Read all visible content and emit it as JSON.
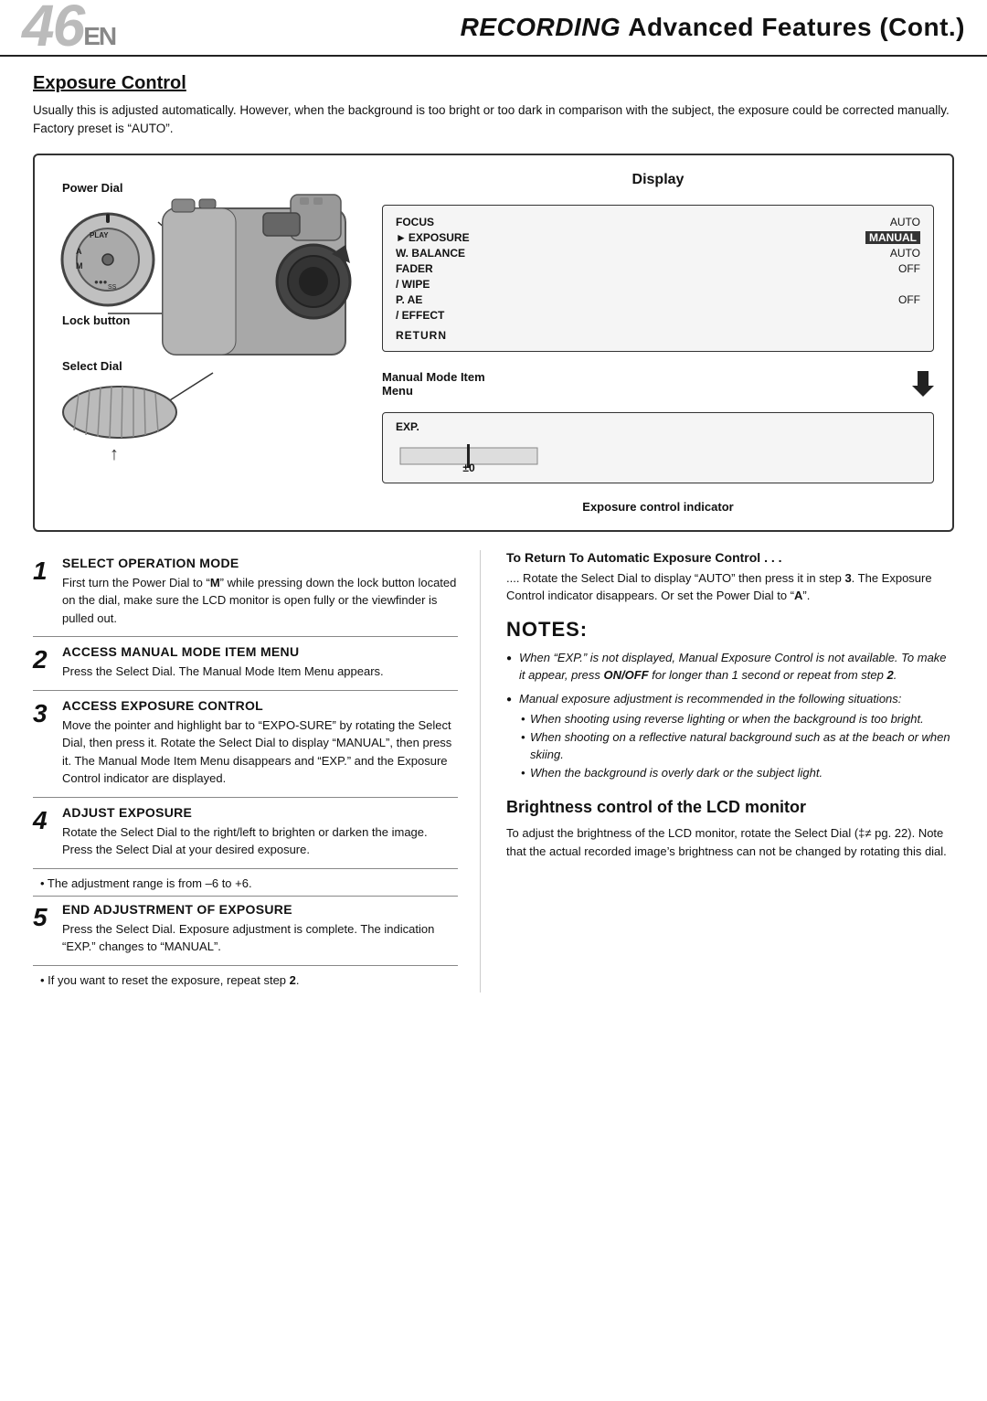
{
  "header": {
    "page_number": "46",
    "page_suffix": "EN",
    "title_italic": "RECORDING",
    "title_rest": "Advanced Features (Cont.)"
  },
  "exposure_control": {
    "heading": "Exposure Control",
    "intro": "Usually this is adjusted automatically. However, when the background is too bright or too dark in comparison with the subject, the exposure could be corrected manually. Factory preset is “AUTO”."
  },
  "diagram": {
    "display_label": "Display",
    "labels": {
      "power_dial": "Power Dial",
      "lock_button": "Lock button",
      "select_dial": "Select Dial",
      "exposure_control_indicator": "Exposure control indicator"
    },
    "display_menu": {
      "rows": [
        {
          "label": "FOCUS",
          "value": "AUTO"
        },
        {
          "label": "►EXPOSURE",
          "value": "MANUAL",
          "highlighted": true
        },
        {
          "label": "W. BALANCE",
          "value": "AUTO"
        },
        {
          "label": "FADER",
          "value": "OFF"
        },
        {
          "label": "/ WIPE",
          "value": ""
        },
        {
          "label": "P. AE",
          "value": "OFF"
        },
        {
          "label": "/ EFFECT",
          "value": ""
        }
      ],
      "return": "RETURN"
    },
    "manual_mode": {
      "label": "Manual Mode Item",
      "sublabel": "Menu"
    },
    "exp_box": {
      "title": "EXP.",
      "value": "±0"
    }
  },
  "steps": [
    {
      "num": "1",
      "title": "SELECT OPERATION MODE",
      "body": "First turn the Power Dial to “M” while pressing down the lock button located on the dial, make sure the LCD monitor is open fully or the viewfinder is pulled out."
    },
    {
      "num": "2",
      "title": "ACCESS MANUAL MODE ITEM MENU",
      "body": "Press the Select Dial. The Manual Mode Item Menu appears."
    },
    {
      "num": "3",
      "title": "ACCESS EXPOSURE CONTROL",
      "body": "Move the pointer and highlight bar to “EXPO-SURE” by rotating the Select Dial, then press it. Rotate the Select Dial to display “MANUAL”, then press it. The Manual Mode Item Menu disappears and “EXP.” and the Exposure Control indicator are displayed."
    },
    {
      "num": "4",
      "title": "ADJUST EXPOSURE",
      "body": "Rotate the Select Dial to the right/left to brighten or darken the image. Press the Select Dial at your desired exposure."
    },
    {
      "num": "4",
      "step_override": true,
      "bullet": "• The adjustment range is from –6 to +6."
    },
    {
      "num": "5",
      "title": "END ADJUSTRMENT OF EXPOSURE",
      "body": "Press the Select Dial. Exposure adjustment is complete. The indication “EXP.” changes to “MANUAL”."
    },
    {
      "num": "5",
      "step_override": true,
      "bullet": "• If you want to reset the exposure, repeat step 2."
    }
  ],
  "return_section": {
    "heading": "To Return To Automatic Exposure Control . . .",
    "body": ".... Rotate the Select Dial to display “AUTO” then press it in step 3. The Exposure Control indicator disappears. Or set the Power Dial to “A”."
  },
  "notes": {
    "heading": "NOTES:",
    "items": [
      {
        "text": "When “EXP.” is not displayed, Manual Exposure Control is not available. To make it appear, press ON/OFF for longer than 1 second or repeat from step 2.",
        "bold_part": "ON/OFF"
      },
      {
        "text": "Manual exposure adjustment is recommended in the following situations:",
        "subitems": [
          "When shooting using reverse lighting or when the background is too bright.",
          "When shooting on a reflective natural background such as at the beach or when skiing.",
          "When the background is overly dark or the subject light."
        ]
      }
    ]
  },
  "brightness": {
    "heading": "Brightness control of the LCD monitor",
    "body": "To adjust the brightness of the LCD monitor, rotate the Select Dial (‡≠ pg. 22). Note that the actual recorded image's brightness can not be changed by rotating this dial."
  }
}
